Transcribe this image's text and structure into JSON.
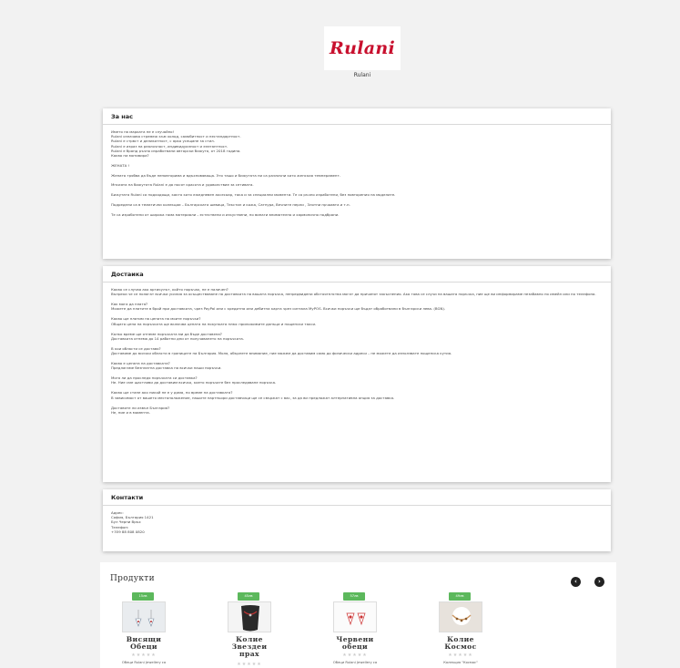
{
  "brand": {
    "logo_text": "Rulani",
    "name": "Rulani"
  },
  "about": {
    "title": "За нас",
    "lines": [
      "Името на марката не е случайно!",
      "Rulani означава стремеж към холод, самобитност и нестандартност.",
      "Rulani е стрвст и деликатност, с ярко усещане за стил.",
      "Rulani е израз на реалочност, индивидуалност и елегантност.",
      "Rulani е бранд ръчно изработвани авторски бижута, от 2018 година.",
      "Какво ни мотивира?"
    ],
    "motto": "ЖЕНАТА !",
    "p1": "Жената трябва да бъде неповторима и вдъхновяваща. Это ташо и бижутата ни са различни като женския темперамент.",
    "p2": "Мнсията на бижутата Rulani е да носят красота и удоволствие за сетивата.",
    "p3": "Бижутата Rulani са подходящи, както като ежедневен аксесоар, така и за специални моменти. Те са ръчно изработени, без повторения на моделите.",
    "p4": "Подредени са в тематични колекции – Българската шевица, Текстил и кожа, Сатнура, Вечните перли , Злотни прчоавта и т.н.",
    "p5": "Те са изработени от широка гама материали – естествени и изкуствени, но винаги внимателно и хармонично подбрани."
  },
  "delivery": {
    "title": "Достаика",
    "items": [
      {
        "q": "Какво се случва ако артикулът, който поръчах, не е наличен?",
        "a": "Въпреки че се полагат всички усилия за осъществяване на доставката на вашата поръчка, непредвидени обстоятелства могат да причинят закъснения. Ако това се случи на вашата поръчка, ние ще ви информираме незабавно по имейл или по телефона."
      },
      {
        "q": "Как мога да платя?",
        "a": "Можете да платите в брой при доставката, чрез PayPal или с кредитна или дебитна карта чрез сигнала MyPOS. Всички поръчки ще бъдат обработвани в български лева. (BGN)."
      },
      {
        "q": "Какво ще платим на цената на моите поръчки?",
        "a": "Общата цена на поръчката ще включва цената на покупката плюс приложимите данъци и пощенски такси."
      },
      {
        "q": "Колко време ще отнеме поръчката ми да бъде доставена?",
        "a": "Доставката отнема до 14 работни дни от получаването на поръчката."
      },
      {
        "q": "В кои области се доставя?",
        "a": "Доставяме до всички области в границите на България. Моля, обърнете внимание, ние можем да доставим само до физически адреси – не можете да използвате пощенска кутия."
      },
      {
        "q": "Какво е цената на доставката?",
        "a": "Предлагаме безплатна доставка на всички наши поръчки."
      },
      {
        "q": "Мога ли да проследя поръчката си доставка?",
        "a": "Не. Ние сме щастливи да доставим всичко, което поръчате без проследяване поръчка."
      },
      {
        "q": "Какво ще стане ако никой не е у дома, по време на доставката?",
        "a": "В зависимост от вашето местоположение, нашите партньори доставчици ще се свържат с вас, за да ви предложат алтернативна опция за доставка."
      },
      {
        "q": "Доставяте ли извън България?",
        "a": "Не, ние и в момента."
      }
    ]
  },
  "contacts": {
    "title": "Контакти",
    "lines": [
      "Адрес:",
      "София, България 1421",
      "Бул Черни Връх",
      "Телефон:",
      "+359 88 808 0820"
    ]
  },
  "products": {
    "title": "Продукти",
    "prev_icon": "‹",
    "next_icon": "›",
    "items": [
      {
        "price": "15лв",
        "name": "Висящи Обеци",
        "stars": "★★★★★",
        "desc": "Обеци Rulani Jewellery са"
      },
      {
        "price": "45лв",
        "name": "Колие Звездеи прах",
        "stars": "★★★★★",
        "desc": ""
      },
      {
        "price": "57лв",
        "name": "Червени обеци",
        "stars": "★★★★★",
        "desc": "Обеци Rulani Jewellery са"
      },
      {
        "price": "49лв",
        "name": "Колие Космос",
        "stars": "★★★★★",
        "desc": "Колекция \"Космос\""
      }
    ]
  },
  "colors": {
    "badge": "#5cb85c",
    "logo": "#c8102e",
    "page_bg": "#f2f2f2"
  }
}
